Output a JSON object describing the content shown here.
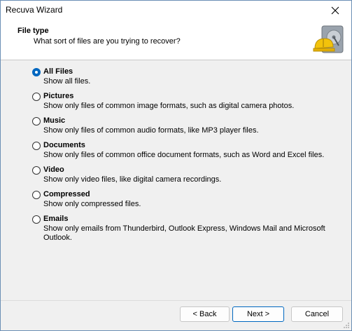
{
  "window": {
    "title": "Recuva Wizard"
  },
  "header": {
    "title": "File type",
    "subtitle": "What sort of files are you trying to recover?"
  },
  "options": [
    {
      "label": "All Files",
      "description": "Show all files.",
      "checked": true
    },
    {
      "label": "Pictures",
      "description": "Show only files of common image formats, such as digital camera photos.",
      "checked": false
    },
    {
      "label": "Music",
      "description": "Show only files of common audio formats, like MP3 player files.",
      "checked": false
    },
    {
      "label": "Documents",
      "description": "Show only files of common office document formats, such as Word and Excel files.",
      "checked": false
    },
    {
      "label": "Video",
      "description": "Show only video files, like digital camera recordings.",
      "checked": false
    },
    {
      "label": "Compressed",
      "description": "Show only compressed files.",
      "checked": false
    },
    {
      "label": "Emails",
      "description": "Show only emails from Thunderbird, Outlook Express, Windows Mail and Microsoft Outlook.",
      "checked": false
    }
  ],
  "buttons": {
    "back": "< Back",
    "next": "Next >",
    "cancel": "Cancel"
  },
  "colors": {
    "accent": "#0067c0",
    "header_bg": "#ffffff",
    "body_bg": "#f0f0f0"
  },
  "icons": {
    "close": "close-icon",
    "logo": "recuva-logo"
  }
}
